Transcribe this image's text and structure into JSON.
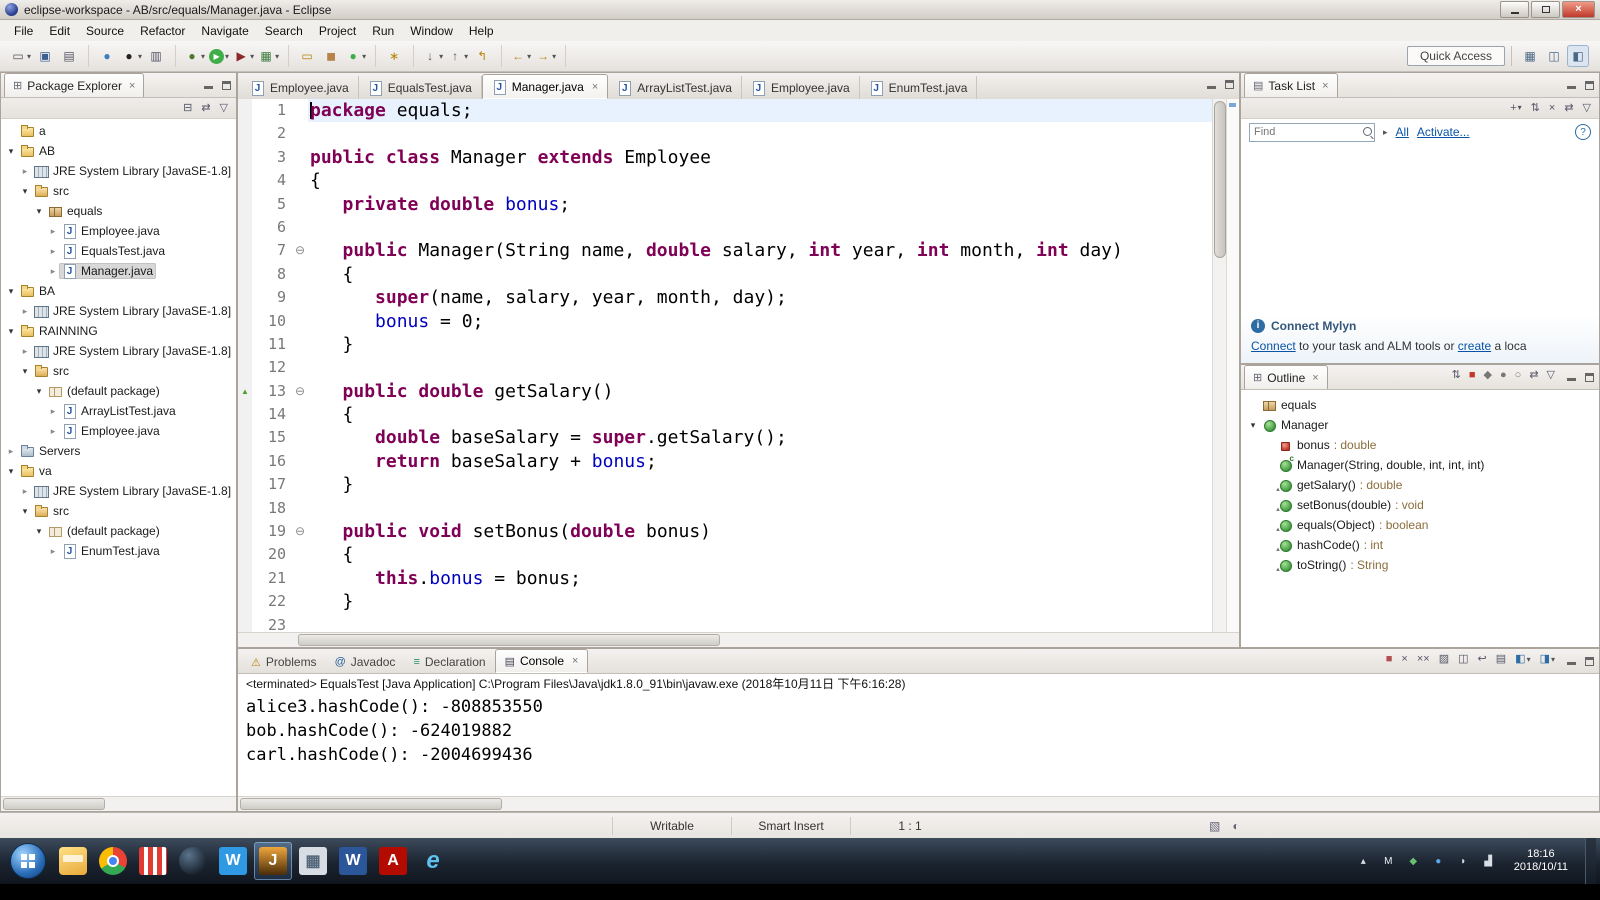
{
  "colors": {
    "keyword": "#7f0055",
    "field": "#0000c0",
    "link": "#0a54a6",
    "current_line": "#e8f2fe",
    "outline_type": "#8a6d3b"
  },
  "window": {
    "title": "eclipse-workspace - AB/src/equals/Manager.java - Eclipse"
  },
  "menubar": {
    "items": [
      "File",
      "Edit",
      "Source",
      "Refactor",
      "Navigate",
      "Search",
      "Project",
      "Run",
      "Window",
      "Help"
    ]
  },
  "toolbar": {
    "groups": [
      [
        {
          "name": "new-wizard",
          "glyph": "▭",
          "fg": "#556",
          "dd": true
        },
        {
          "name": "save",
          "glyph": "▣",
          "fg": "#3a5f8f"
        },
        {
          "name": "print",
          "glyph": "▤",
          "fg": "#556"
        }
      ],
      [
        {
          "name": "open-web-browser",
          "glyph": "●",
          "fg": "#3a7fc1"
        },
        {
          "name": "record",
          "glyph": "●",
          "fg": "#222",
          "dd": true
        },
        {
          "name": "console-view",
          "glyph": "▥",
          "fg": "#556"
        }
      ],
      [
        {
          "name": "debug",
          "glyph": "●",
          "fg": "#4a7a2a",
          "dd": true
        },
        {
          "name": "run",
          "glyph": "▶",
          "fg": "#fff",
          "bg": "#3fae49",
          "dd": true
        },
        {
          "name": "run-external-tools",
          "glyph": "▶",
          "fg": "#8a2a2a",
          "dd": true
        },
        {
          "name": "coverage",
          "glyph": "▦",
          "fg": "#3a7a3a",
          "dd": true
        }
      ],
      [
        {
          "name": "new-java-project",
          "glyph": "▭",
          "fg": "#b8860b"
        },
        {
          "name": "new-package",
          "glyph": "◼",
          "fg": "#b5854b"
        },
        {
          "name": "new-class",
          "glyph": "●",
          "fg": "#3fae49",
          "dd": true
        }
      ],
      [
        {
          "name": "search",
          "glyph": "∗",
          "fg": "#b8860b"
        }
      ],
      [
        {
          "name": "next-annotation",
          "glyph": "↓",
          "fg": "#556",
          "dd": true
        },
        {
          "name": "previous-annotation",
          "glyph": "↑",
          "fg": "#556",
          "dd": true
        },
        {
          "name": "last-edit-location",
          "glyph": "↰",
          "fg": "#b8860b"
        }
      ],
      [
        {
          "name": "back",
          "glyph": "←",
          "fg": "#b8860b",
          "dd": true
        },
        {
          "name": "forward",
          "glyph": "→",
          "fg": "#b8860b",
          "dd": true
        }
      ]
    ],
    "quick_access": "Quick Access",
    "perspectives": [
      {
        "name": "open-perspective",
        "glyph": "▦"
      },
      {
        "name": "java-ee-perspective",
        "glyph": "◫"
      },
      {
        "name": "java-perspective",
        "glyph": "◧",
        "active": true
      }
    ]
  },
  "package_explorer": {
    "title": "Package Explorer",
    "toolbar": [
      {
        "name": "collapse-all",
        "glyph": "⊟"
      },
      {
        "name": "link-with-editor",
        "glyph": "⇄"
      },
      {
        "name": "view-menu",
        "glyph": "▽"
      }
    ],
    "tree": [
      {
        "label": "a",
        "icon": "project",
        "depth": 0,
        "arrow": "none"
      },
      {
        "label": "AB",
        "icon": "project",
        "depth": 0,
        "arrow": "open"
      },
      {
        "label": "JRE System Library [JavaSE-1.8]",
        "icon": "library",
        "depth": 1,
        "arrow": "closed"
      },
      {
        "label": "src",
        "icon": "src",
        "depth": 1,
        "arrow": "open"
      },
      {
        "label": "equals",
        "icon": "package",
        "depth": 2,
        "arrow": "open"
      },
      {
        "label": "Employee.java",
        "icon": "jfile",
        "depth": 3,
        "arrow": "closed"
      },
      {
        "label": "EqualsTest.java",
        "icon": "jfile",
        "depth": 3,
        "arrow": "closed"
      },
      {
        "label": "Manager.java",
        "icon": "jfile",
        "depth": 3,
        "arrow": "closed",
        "selected": true
      },
      {
        "label": "BA",
        "icon": "project",
        "depth": 0,
        "arrow": "open"
      },
      {
        "label": "JRE System Library [JavaSE-1.8]",
        "icon": "library",
        "depth": 1,
        "arrow": "closed"
      },
      {
        "label": "RAINNING",
        "icon": "project",
        "depth": 0,
        "arrow": "open"
      },
      {
        "label": "JRE System Library [JavaSE-1.8]",
        "icon": "library",
        "depth": 1,
        "arrow": "closed"
      },
      {
        "label": "src",
        "icon": "src",
        "depth": 1,
        "arrow": "open"
      },
      {
        "label": "(default package)",
        "icon": "package-empty",
        "depth": 2,
        "arrow": "open"
      },
      {
        "label": "ArrayListTest.java",
        "icon": "jfile",
        "depth": 3,
        "arrow": "closed"
      },
      {
        "label": "Employee.java",
        "icon": "jfile",
        "depth": 3,
        "arrow": "closed"
      },
      {
        "label": "Servers",
        "icon": "servers",
        "depth": 0,
        "arrow": "closed"
      },
      {
        "label": "va",
        "icon": "project",
        "depth": 0,
        "arrow": "open"
      },
      {
        "label": "JRE System Library [JavaSE-1.8]",
        "icon": "library",
        "depth": 1,
        "arrow": "closed"
      },
      {
        "label": "src",
        "icon": "src",
        "depth": 1,
        "arrow": "open"
      },
      {
        "label": "(default package)",
        "icon": "package-empty",
        "depth": 2,
        "arrow": "open"
      },
      {
        "label": "EnumTest.java",
        "icon": "jfile",
        "depth": 3,
        "arrow": "closed"
      }
    ]
  },
  "editor": {
    "tabs": [
      {
        "label": "Employee.java",
        "active": false
      },
      {
        "label": "EqualsTest.java",
        "active": false
      },
      {
        "label": "Manager.java",
        "active": true
      },
      {
        "label": "ArrayListTest.java",
        "active": false
      },
      {
        "label": "Employee.java",
        "active": false
      },
      {
        "label": "EnumTest.java",
        "active": false
      }
    ],
    "lines": [
      {
        "n": 1,
        "current": true,
        "tokens": [
          [
            "k",
            "package"
          ],
          [
            "p",
            " equals;"
          ]
        ]
      },
      {
        "n": 2,
        "tokens": []
      },
      {
        "n": 3,
        "tokens": [
          [
            "k",
            "public"
          ],
          [
            "p",
            " "
          ],
          [
            "k",
            "class"
          ],
          [
            "p",
            " Manager "
          ],
          [
            "k",
            "extends"
          ],
          [
            "p",
            " Employee"
          ]
        ]
      },
      {
        "n": 4,
        "tokens": [
          [
            "p",
            "{"
          ]
        ]
      },
      {
        "n": 5,
        "tokens": [
          [
            "p",
            "   "
          ],
          [
            "k",
            "private"
          ],
          [
            "p",
            " "
          ],
          [
            "k",
            "double"
          ],
          [
            "p",
            " "
          ],
          [
            "f",
            "bonus"
          ],
          [
            "p",
            ";"
          ]
        ]
      },
      {
        "n": 6,
        "tokens": []
      },
      {
        "n": 7,
        "fold": true,
        "tokens": [
          [
            "p",
            "   "
          ],
          [
            "k",
            "public"
          ],
          [
            "p",
            " Manager(String name, "
          ],
          [
            "k",
            "double"
          ],
          [
            "p",
            " salary, "
          ],
          [
            "k",
            "int"
          ],
          [
            "p",
            " year, "
          ],
          [
            "k",
            "int"
          ],
          [
            "p",
            " month, "
          ],
          [
            "k",
            "int"
          ],
          [
            "p",
            " day)"
          ]
        ]
      },
      {
        "n": 8,
        "tokens": [
          [
            "p",
            "   {"
          ]
        ]
      },
      {
        "n": 9,
        "tokens": [
          [
            "p",
            "      "
          ],
          [
            "k",
            "super"
          ],
          [
            "p",
            "(name, salary, year, month, day);"
          ]
        ]
      },
      {
        "n": 10,
        "tokens": [
          [
            "p",
            "      "
          ],
          [
            "f",
            "bonus"
          ],
          [
            "p",
            " = 0;"
          ]
        ]
      },
      {
        "n": 11,
        "tokens": [
          [
            "p",
            "   }"
          ]
        ]
      },
      {
        "n": 12,
        "tokens": []
      },
      {
        "n": 13,
        "fold": true,
        "marker": "last-edit",
        "tokens": [
          [
            "p",
            "   "
          ],
          [
            "k",
            "public"
          ],
          [
            "p",
            " "
          ],
          [
            "k",
            "double"
          ],
          [
            "p",
            " getSalary()"
          ]
        ]
      },
      {
        "n": 14,
        "tokens": [
          [
            "p",
            "   {"
          ]
        ]
      },
      {
        "n": 15,
        "tokens": [
          [
            "p",
            "      "
          ],
          [
            "k",
            "double"
          ],
          [
            "p",
            " baseSalary = "
          ],
          [
            "k",
            "super"
          ],
          [
            "p",
            ".getSalary();"
          ]
        ]
      },
      {
        "n": 16,
        "tokens": [
          [
            "p",
            "      "
          ],
          [
            "k",
            "return"
          ],
          [
            "p",
            " baseSalary + "
          ],
          [
            "f",
            "bonus"
          ],
          [
            "p",
            ";"
          ]
        ]
      },
      {
        "n": 17,
        "tokens": [
          [
            "p",
            "   }"
          ]
        ]
      },
      {
        "n": 18,
        "tokens": []
      },
      {
        "n": 19,
        "fold": true,
        "tokens": [
          [
            "p",
            "   "
          ],
          [
            "k",
            "public"
          ],
          [
            "p",
            " "
          ],
          [
            "k",
            "void"
          ],
          [
            "p",
            " setBonus("
          ],
          [
            "k",
            "double"
          ],
          [
            "p",
            " bonus)"
          ]
        ]
      },
      {
        "n": 20,
        "tokens": [
          [
            "p",
            "   {"
          ]
        ]
      },
      {
        "n": 21,
        "tokens": [
          [
            "p",
            "      "
          ],
          [
            "k",
            "this"
          ],
          [
            "p",
            "."
          ],
          [
            "f",
            "bonus"
          ],
          [
            "p",
            " = bonus;"
          ]
        ]
      },
      {
        "n": 22,
        "tokens": [
          [
            "p",
            "   }"
          ]
        ]
      },
      {
        "n": 23,
        "tokens": []
      }
    ]
  },
  "task_list": {
    "title": "Task List",
    "toolbar": [
      {
        "name": "new-task",
        "glyph": "+",
        "dd": true
      },
      {
        "name": "synchronize",
        "glyph": "⇅"
      },
      {
        "name": "delete-task",
        "glyph": "×"
      },
      {
        "name": "link-with-editor",
        "glyph": "⇄"
      },
      {
        "name": "view-menu",
        "glyph": "▽"
      }
    ],
    "find_placeholder": "Find",
    "links": {
      "all": "All",
      "activate": "Activate..."
    },
    "mylyn": {
      "heading": "Connect Mylyn",
      "body": [
        {
          "text": "Connect",
          "link": true
        },
        {
          "text": " to your task and ALM tools or ",
          "link": false
        },
        {
          "text": "create",
          "link": true
        },
        {
          "text": " a loca",
          "link": false
        }
      ]
    }
  },
  "outline": {
    "title": "Outline",
    "toolbar": [
      {
        "name": "sort",
        "glyph": "⇅"
      },
      {
        "name": "hide-fields",
        "glyph": "■",
        "fg": "#c0392b"
      },
      {
        "name": "hide-static-members",
        "glyph": "◆",
        "fg": "#777"
      },
      {
        "name": "hide-non-public-members",
        "glyph": "●",
        "fg": "#777"
      },
      {
        "name": "hide-local-types",
        "glyph": "○",
        "fg": "#777"
      },
      {
        "name": "link-with-editor",
        "glyph": "⇄"
      },
      {
        "name": "view-menu",
        "glyph": "▽"
      }
    ],
    "items": [
      {
        "label": "equals",
        "suffix": "",
        "icon": "package",
        "depth": 0,
        "arrow": "none"
      },
      {
        "label": "Manager",
        "suffix": "",
        "icon": "class",
        "depth": 0,
        "arrow": "open"
      },
      {
        "label": "bonus",
        "suffix": " : double",
        "icon": "field-private",
        "depth": 1,
        "arrow": "none"
      },
      {
        "label": "Manager(String, double, int, int, int)",
        "suffix": "",
        "icon": "constructor",
        "depth": 1,
        "arrow": "none"
      },
      {
        "label": "getSalary()",
        "suffix": " : double",
        "icon": "method",
        "depth": 1,
        "arrow": "none",
        "override": true
      },
      {
        "label": "setBonus(double)",
        "suffix": " : void",
        "icon": "method",
        "depth": 1,
        "arrow": "none",
        "override": true
      },
      {
        "label": "equals(Object)",
        "suffix": " : boolean",
        "icon": "method",
        "depth": 1,
        "arrow": "none",
        "override": true
      },
      {
        "label": "hashCode()",
        "suffix": " : int",
        "icon": "method",
        "depth": 1,
        "arrow": "none",
        "override": true
      },
      {
        "label": "toString()",
        "suffix": " : String",
        "icon": "method",
        "depth": 1,
        "arrow": "none",
        "override": true
      }
    ]
  },
  "console": {
    "tabs": [
      {
        "label": "Problems",
        "glyph": "⚠",
        "color": "#b8860b",
        "active": false
      },
      {
        "label": "Javadoc",
        "glyph": "@",
        "color": "#2a6099",
        "active": false
      },
      {
        "label": "Declaration",
        "glyph": "≡",
        "color": "#2a8f6f",
        "active": false
      },
      {
        "label": "Console",
        "glyph": "▤",
        "color": "#445",
        "active": true
      }
    ],
    "toolbar": [
      {
        "name": "terminate",
        "glyph": "■",
        "fg": "#b05050"
      },
      {
        "name": "remove-launch",
        "glyph": "×"
      },
      {
        "name": "remove-all-terminated",
        "glyph": "××"
      },
      {
        "name": "clear-console",
        "glyph": "▨"
      },
      {
        "name": "scroll-lock",
        "glyph": "◫"
      },
      {
        "name": "word-wrap",
        "glyph": "↩"
      },
      {
        "name": "pin-console",
        "glyph": "▤"
      },
      {
        "name": "display-selected-console",
        "glyph": "◧",
        "fg": "#2e6da4",
        "dd": true
      },
      {
        "name": "open-console",
        "glyph": "◨",
        "fg": "#2e6da4",
        "dd": true
      }
    ],
    "header": "<terminated> EqualsTest [Java Application] C:\\Program Files\\Java\\jdk1.8.0_91\\bin\\javaw.exe (2018年10月11日 下午6:16:28)",
    "lines": [
      "alice3.hashCode(): -808853550",
      "bob.hashCode(): -624019882",
      "carl.hashCode(): -2004699436"
    ]
  },
  "status_bar": {
    "writable": "Writable",
    "smart_insert": "Smart Insert",
    "caret_position": "1 : 1",
    "icons": [
      {
        "name": "editor-presentation",
        "glyph": "▧"
      },
      {
        "name": "background-progress",
        "glyph": "◐"
      }
    ]
  },
  "taskbar": {
    "icons": [
      {
        "name": "file-explorer"
      },
      {
        "name": "chrome"
      },
      {
        "name": "app-red"
      },
      {
        "name": "app-globe"
      },
      {
        "name": "wps-writer",
        "glyph": "W",
        "fg": "#fff",
        "bg": "#2f9ae3"
      },
      {
        "name": "java-ee",
        "glyph": "J",
        "fg": "#fff",
        "bg": "linear-gradient(#f0a63c,#4a2c08)",
        "active": true
      },
      {
        "name": "app-gray",
        "glyph": "▦",
        "fg": "#55677a",
        "bg": "#d7dde3"
      },
      {
        "name": "word",
        "glyph": "W",
        "fg": "#fff",
        "bg": "#2b579a"
      },
      {
        "name": "adobe-reader",
        "glyph": "A",
        "fg": "#fff",
        "bg": "#b30b00"
      },
      {
        "name": "internet-explorer",
        "glyph": "e",
        "fg": "#5fc0f0"
      }
    ],
    "tray": [
      {
        "name": "show-hidden-icons",
        "glyph": "▴",
        "fg": "#d7dee6"
      },
      {
        "name": "input-method-indicator",
        "glyph": "M",
        "fg": "#e8eef4"
      },
      {
        "name": "security-status",
        "glyph": "◆",
        "fg": "#69c06f"
      },
      {
        "name": "cloud-sync",
        "glyph": "●",
        "fg": "#5aa7e8"
      },
      {
        "name": "volume",
        "glyph": "◗",
        "fg": "#d7dee6"
      },
      {
        "name": "network-status",
        "glyph": "▟",
        "fg": "#d7dee6"
      }
    ],
    "time": "18:16",
    "date": "2018/10/11"
  }
}
